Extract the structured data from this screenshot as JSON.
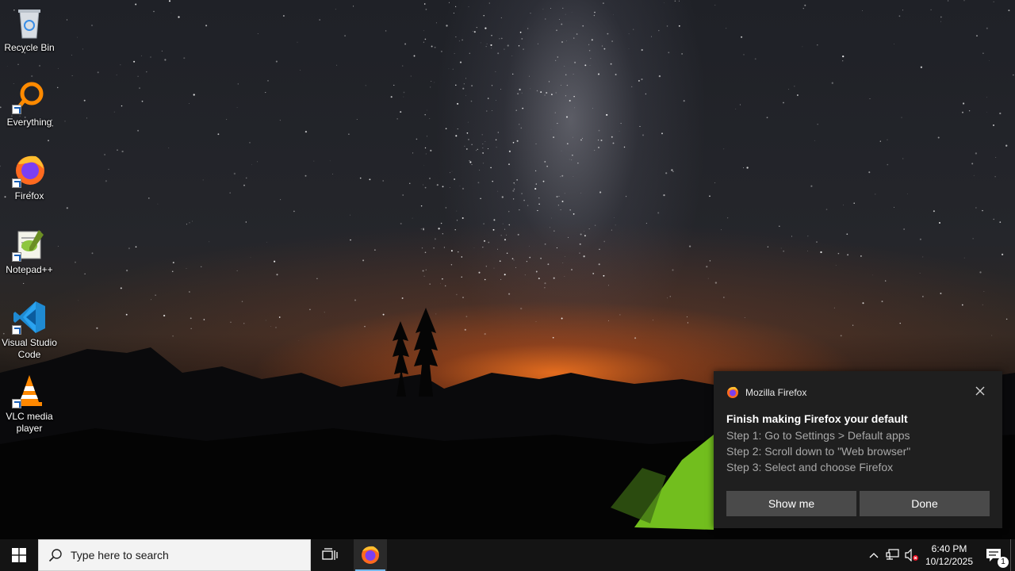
{
  "desktop": {
    "icons": [
      {
        "label": "Recycle Bin"
      },
      {
        "label": "Everything"
      },
      {
        "label": "Firefox"
      },
      {
        "label": "Notepad++"
      },
      {
        "label": "Visual Studio Code"
      },
      {
        "label": "VLC media player"
      }
    ]
  },
  "toast": {
    "app_name": "Mozilla Firefox",
    "close_icon": "close-icon",
    "title": "Finish making Firefox your default",
    "lines": [
      "Step 1: Go to Settings > Default apps",
      "Step 2: Scroll down to \"Web browser\"",
      "Step 3: Select and choose Firefox"
    ],
    "primary_button": "Show me",
    "secondary_button": "Done"
  },
  "taskbar": {
    "search_placeholder": "Type here to search",
    "clock": {
      "time": "6:40 PM",
      "date": "10/12/2025"
    },
    "notification_count": "1",
    "pinned": [
      "Firefox"
    ],
    "tray_icons": [
      "chevron-up-icon",
      "network-icon",
      "volume-muted-icon",
      "action-center-icon"
    ]
  },
  "colors": {
    "taskbar_bg": "#141414",
    "toast_bg": "#1f1f1f",
    "toast_button_bg": "#4a4a4a",
    "accent": "#76b9ed"
  }
}
